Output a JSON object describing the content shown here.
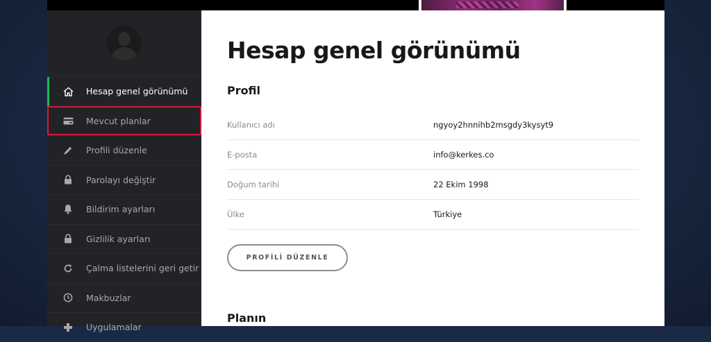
{
  "sidebar": {
    "items": [
      {
        "label": "Hesap genel görünümü",
        "icon": "home-icon"
      },
      {
        "label": "Mevcut planlar",
        "icon": "credit-card-icon"
      },
      {
        "label": "Profili düzenle",
        "icon": "pencil-icon"
      },
      {
        "label": "Parolayı değiştir",
        "icon": "lock-icon"
      },
      {
        "label": "Bildirim ayarları",
        "icon": "bell-icon"
      },
      {
        "label": "Gizlilik ayarları",
        "icon": "lock-icon"
      },
      {
        "label": "Çalma listelerini geri getir",
        "icon": "refresh-icon"
      },
      {
        "label": "Makbuzlar",
        "icon": "clock-icon"
      },
      {
        "label": "Uygulamalar",
        "icon": "puzzle-icon"
      }
    ],
    "active_index": 0,
    "highlighted_index": 1
  },
  "main": {
    "title": "Hesap genel görünümü",
    "profile": {
      "heading": "Profil",
      "rows": [
        {
          "label": "Kullanıcı adı",
          "value": "ngyoy2hnnihb2msgdy3kysyt9"
        },
        {
          "label": "E-posta",
          "value": "info@kerkes.co"
        },
        {
          "label": "Doğum tarihi",
          "value": "22 Ekim 1998"
        },
        {
          "label": "Ülke",
          "value": "Türkiye"
        }
      ],
      "edit_button": "PROFİLİ DÜZENLE"
    },
    "plan_heading": "Planın"
  },
  "colors": {
    "accent": "#1db954",
    "highlight_border": "#d8193a",
    "sidebar_bg": "#222326",
    "page_bg": "#1a2a44"
  }
}
